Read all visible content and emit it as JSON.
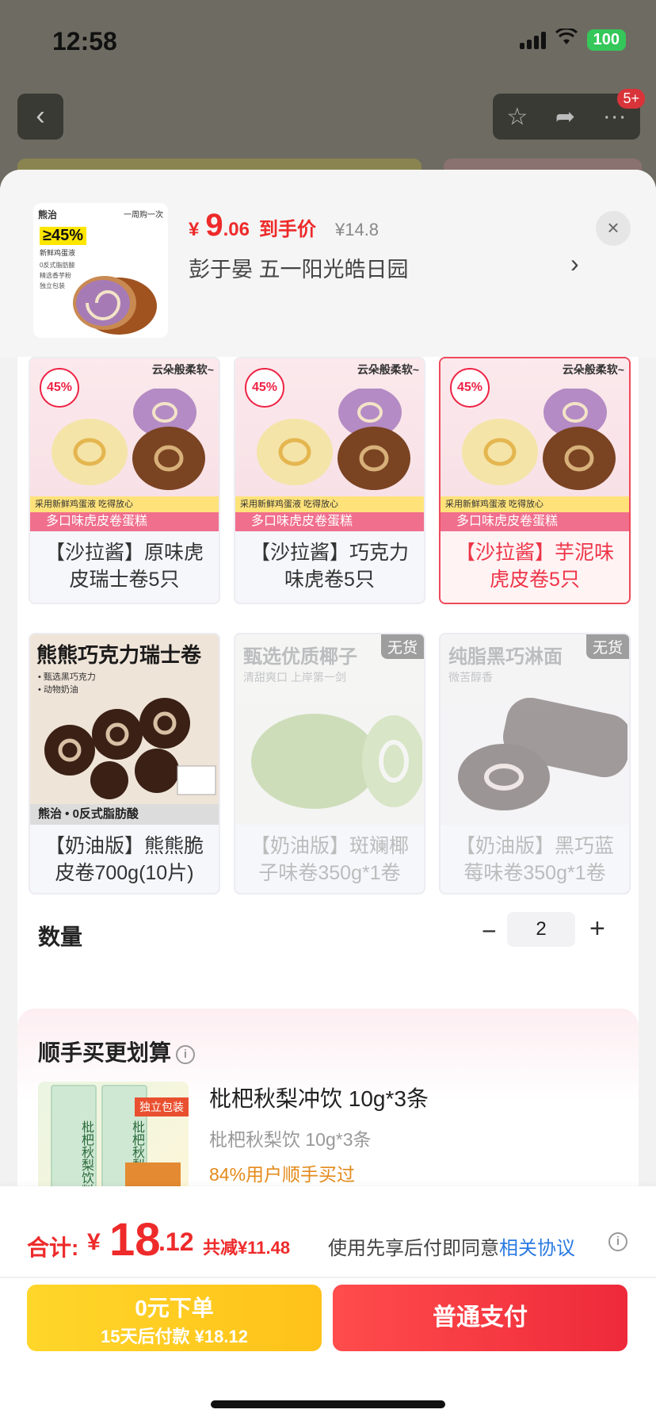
{
  "status": {
    "time": "12:58",
    "battery": "100"
  },
  "background": {
    "badge": "5+"
  },
  "header": {
    "thumb": {
      "brand": "熊治",
      "tag": "一周购一次",
      "pct": "≥45%",
      "sub": "新鲜鸡蛋液",
      "list": [
        "0反式脂肪酸",
        "精选香芋粉",
        "独立包装"
      ]
    },
    "price_symbol": "¥",
    "price_int": "9",
    "price_dec": ".06",
    "price_label": "到手价",
    "orig_price": "¥14.8",
    "variant_name": "彭于晏  五一阳光皓日园",
    "close": "×"
  },
  "options": [
    {
      "label": "【沙拉酱】原味虎皮瑞士卷5只",
      "state": "normal",
      "pct": "45%",
      "caption": "云朵般柔软~",
      "strip1": "采用新鲜鸡蛋液 吃得放心",
      "strip2": "多口味虎皮卷蛋糕"
    },
    {
      "label": "【沙拉酱】巧克力味虎卷5只",
      "state": "normal",
      "pct": "45%",
      "caption": "云朵般柔软~",
      "strip1": "采用新鲜鸡蛋液 吃得放心",
      "strip2": "多口味虎皮卷蛋糕"
    },
    {
      "label": "【沙拉酱】芋泥味虎皮卷5只",
      "state": "selected",
      "pct": "45%",
      "caption": "云朵般柔软~",
      "strip1": "采用新鲜鸡蛋液 吃得放心",
      "strip2": "多口味虎皮卷蛋糕"
    },
    {
      "label": "【奶油版】熊熊脆皮卷700g(10片)",
      "state": "normal",
      "title": "熊熊巧克力瑞士卷",
      "list1": "• 甄选黑巧克力",
      "list2": "• 动物奶油",
      "foot": "熊治  •  0反式脂肪酸"
    },
    {
      "label": "【奶油版】斑斓椰子味卷350g*1卷",
      "state": "disabled",
      "badge": "无货",
      "title": "甄选优质椰子",
      "sub": "清甜爽口   上岸第一剑"
    },
    {
      "label": "【奶油版】黑巧蓝莓味卷350g*1卷",
      "state": "disabled",
      "badge": "无货",
      "title": "纯脂黑巧淋面",
      "sub": "微苦醇香"
    }
  ],
  "quantity": {
    "label": "数量",
    "value": "2",
    "minus": "−",
    "plus": "+"
  },
  "addon": {
    "title": "顺手买更划算",
    "name": "枇杷秋梨冲饮 10g*3条",
    "spec": "枇杷秋梨饮 10g*3条",
    "stat": "84%用户顺手买过",
    "pack_text": "枇杷秋梨饮料",
    "tag": "独立包装"
  },
  "bottom": {
    "total_label": "合计:",
    "total_symbol": "¥",
    "total_int": "18",
    "total_dec": ".12",
    "save": "共减¥11.48",
    "agree_prefix": "使用先享后付即同意",
    "agree_link": "相关协议",
    "later_line1": "0元下单",
    "later_line2": "15天后付款 ¥18.12",
    "pay_label": "普通支付"
  },
  "colors": {
    "accent": "#ee2a2a",
    "selected_border": "#ee4a5c",
    "link": "#2a7ae2",
    "later_btn": "#ffc21a"
  }
}
